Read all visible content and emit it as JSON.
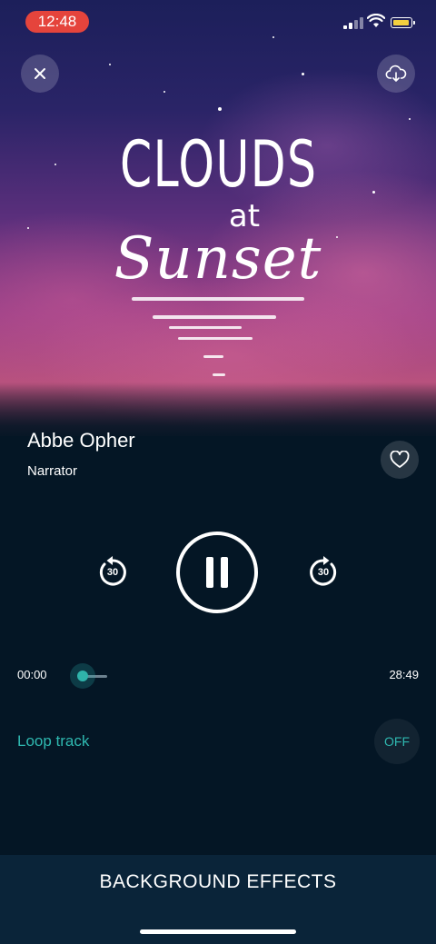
{
  "status_bar": {
    "time": "12:48"
  },
  "artwork": {
    "line1": "CLOUDS",
    "line2": "at",
    "line3": "Sunset"
  },
  "track": {
    "artist": "Abbe Opher",
    "role": "Narrator"
  },
  "controls": {
    "rewind_seconds": "30",
    "forward_seconds": "30"
  },
  "progress": {
    "elapsed": "00:00",
    "duration": "28:49",
    "fraction": 0.0
  },
  "loop": {
    "label": "Loop track",
    "state": "OFF"
  },
  "bottom": {
    "label": "BACKGROUND EFFECTS"
  },
  "colors": {
    "accent": "#2fb8b0",
    "background": "#041625",
    "time_pill": "#e5443c"
  },
  "icons": {
    "close": "close-icon",
    "download": "cloud-download-icon",
    "favorite": "heart-icon",
    "rewind": "rewind-30-icon",
    "forward": "forward-30-icon",
    "pause": "pause-icon"
  }
}
